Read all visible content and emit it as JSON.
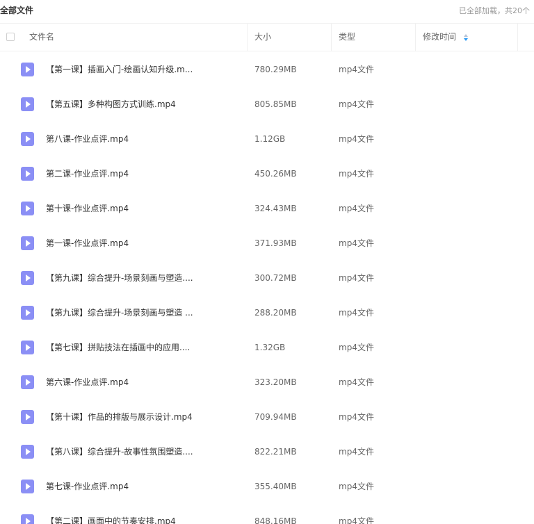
{
  "top": {
    "title": "全部文件",
    "status": "已全部加载，共20个"
  },
  "columns": {
    "name": "文件名",
    "size": "大小",
    "type": "类型",
    "modified": "修改时间"
  },
  "colors": {
    "icon": "#8b8ff5",
    "sort_active": "#2d9cf5",
    "sort_inactive": "#b8c4d6"
  },
  "files": [
    {
      "name": "【第一课】插画入门-绘画认知升级.m...",
      "size": "780.29MB",
      "type": "mp4文件"
    },
    {
      "name": "【第五课】多种构图方式训练.mp4",
      "size": "805.85MB",
      "type": "mp4文件"
    },
    {
      "name": "第八课-作业点评.mp4",
      "size": "1.12GB",
      "type": "mp4文件"
    },
    {
      "name": "第二课-作业点评.mp4",
      "size": "450.26MB",
      "type": "mp4文件"
    },
    {
      "name": "第十课-作业点评.mp4",
      "size": "324.43MB",
      "type": "mp4文件"
    },
    {
      "name": "第一课-作业点评.mp4",
      "size": "371.93MB",
      "type": "mp4文件"
    },
    {
      "name": "【第九课】综合提升-场景刻画与塑造....",
      "size": "300.72MB",
      "type": "mp4文件"
    },
    {
      "name": "【第九课】综合提升-场景刻画与塑造 ...",
      "size": "288.20MB",
      "type": "mp4文件"
    },
    {
      "name": "【第七课】拼贴技法在插画中的应用....",
      "size": "1.32GB",
      "type": "mp4文件"
    },
    {
      "name": "第六课-作业点评.mp4",
      "size": "323.20MB",
      "type": "mp4文件"
    },
    {
      "name": "【第十课】作品的排版与展示设计.mp4",
      "size": "709.94MB",
      "type": "mp4文件"
    },
    {
      "name": "【第八课】综合提升-故事性氛围塑造....",
      "size": "822.21MB",
      "type": "mp4文件"
    },
    {
      "name": "第七课-作业点评.mp4",
      "size": "355.40MB",
      "type": "mp4文件"
    },
    {
      "name": "【第二课】画面中的节奏安排.mp4",
      "size": "848.16MB",
      "type": "mp4文件"
    }
  ]
}
